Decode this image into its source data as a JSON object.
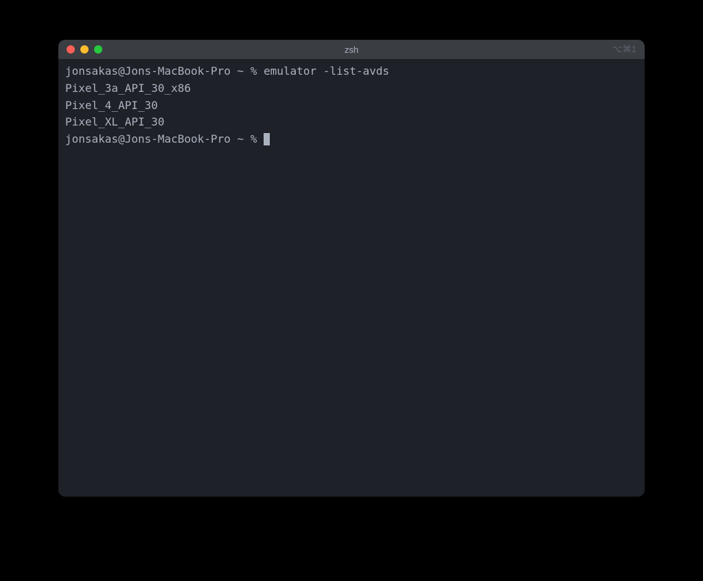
{
  "window": {
    "title": "zsh",
    "shortcut_hint": "⌥⌘1"
  },
  "terminal": {
    "prompt": "jonsakas@Jons-MacBook-Pro ~ % ",
    "command": "emulator -list-avds",
    "output": [
      "Pixel_3a_API_30_x86",
      "Pixel_4_API_30",
      "Pixel_XL_API_30"
    ]
  },
  "colors": {
    "close": "#ff5f56",
    "minimize": "#ffbd2e",
    "zoom": "#27c93f",
    "background": "#1e2127",
    "titlebar": "#3a3d42",
    "text": "#abb2bf"
  }
}
